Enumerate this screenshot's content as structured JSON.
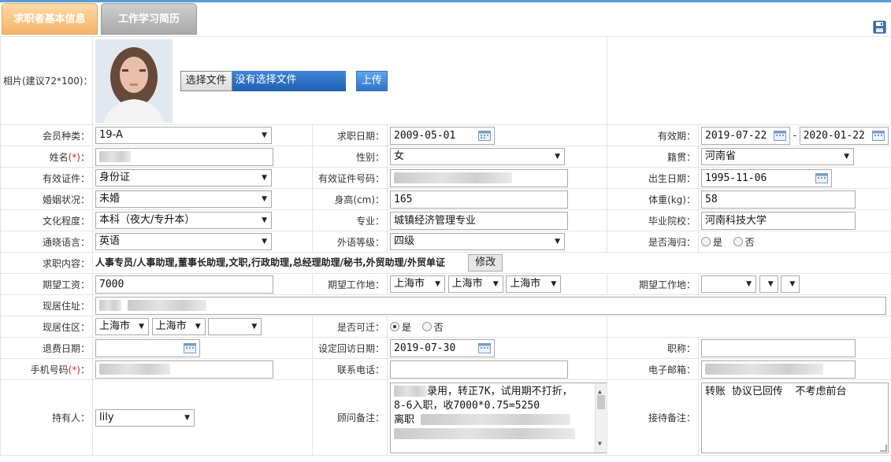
{
  "tabs": {
    "basic": "求职者基本信息",
    "history": "工作学习简历"
  },
  "photo": {
    "label": "相片(建议72*100)：",
    "choose_file": "选择文件",
    "no_file": "没有选择文件",
    "upload": "上传"
  },
  "member_type": {
    "label": "会员种类：",
    "value": "19-A"
  },
  "apply_date": {
    "label": "求职日期：",
    "value": "2009-05-01"
  },
  "valid_period": {
    "label": "有效期：",
    "from": "2019-07-22",
    "sep": "-",
    "to": "2020-01-22"
  },
  "name": {
    "label": "姓名",
    "req": "(*)",
    "colon": "："
  },
  "gender": {
    "label": "性别：",
    "value": "女"
  },
  "native_place": {
    "label": "籍贯：",
    "value": "河南省"
  },
  "id_type": {
    "label": "有效证件：",
    "value": "身份证"
  },
  "id_number": {
    "label": "有效证件号码："
  },
  "birth_date": {
    "label": "出生日期：",
    "value": "1995-11-06"
  },
  "marital": {
    "label": "婚姻状况：",
    "value": "未婚"
  },
  "height": {
    "label": "身高(cm)：",
    "value": "165"
  },
  "weight": {
    "label": "体重(kg)：",
    "value": "58"
  },
  "education": {
    "label": "文化程度：",
    "value": "本科（夜大/专升本）"
  },
  "major": {
    "label": "专业：",
    "value": "城镇经济管理专业"
  },
  "school": {
    "label": "毕业院校：",
    "value": "河南科技大学"
  },
  "language": {
    "label": "通晓语言：",
    "value": "英语"
  },
  "language_level": {
    "label": "外语等级：",
    "value": "四级"
  },
  "returnee": {
    "label": "是否海归：",
    "yes": "是",
    "no": "否"
  },
  "job_content": {
    "label": "求职内容：",
    "value": "人事专员/人事助理,董事长助理,文职,行政助理,总经理助理/秘书,外贸助理/外贸单证",
    "modify": "修改"
  },
  "salary": {
    "label": "期望工资：",
    "value": "7000"
  },
  "work_place1": {
    "label": "期望工作地：",
    "province": "上海市",
    "city": "上海市",
    "district": "上海市"
  },
  "work_place2": {
    "label": "期望工作地："
  },
  "address": {
    "label": "现居住址："
  },
  "area": {
    "label": "现居住区：",
    "province": "上海市",
    "city": "上海市"
  },
  "relocate": {
    "label": "是否可迁：",
    "yes": "是",
    "no": "否"
  },
  "refund_date": {
    "label": "退费日期："
  },
  "visit_date": {
    "label": "设定回访日期：",
    "value": "2019-07-30"
  },
  "title": {
    "label": "职称："
  },
  "mobile": {
    "label": "手机号码",
    "req": "(*)",
    "colon": "："
  },
  "phone": {
    "label": "联系电话："
  },
  "email": {
    "label": "电子邮箱："
  },
  "holder": {
    "label": "持有人：",
    "value": "lily"
  },
  "advisor_note": {
    "label": "顾问备注：",
    "line1": "录用，转正7K，试用期不打折，",
    "line2": "8-6入职，收7000*0.75=5250",
    "line3": "离职"
  },
  "reception_note": {
    "label": "接待备注：",
    "value": "转账 协议已回传  不考虑前台"
  },
  "colors": {
    "tab_active": "#f5b469",
    "tab_inactive": "#a9a9a9",
    "upload_blue": "#2f74c9",
    "required": "#d22222"
  }
}
